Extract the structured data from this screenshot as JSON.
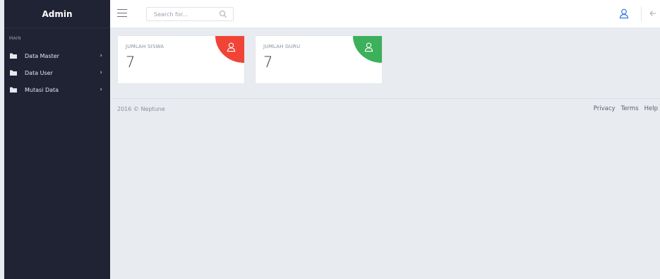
{
  "sidebar": {
    "brand": "Admin",
    "section_label": "MAIN",
    "items": [
      {
        "label": "Data Master",
        "icon": "folder-icon"
      },
      {
        "label": "Data User",
        "icon": "folder-icon"
      },
      {
        "label": "Mutasi Data",
        "icon": "folder-icon"
      }
    ]
  },
  "header": {
    "search_placeholder": "Search for...",
    "icons": [
      "menu-icon",
      "search-icon",
      "user-icon",
      "arrow-left-icon"
    ]
  },
  "cards": [
    {
      "title": "JUMLAH SISWA",
      "value": "7",
      "color": "#f04437",
      "icon": "user-icon"
    },
    {
      "title": "JUMLAH GURU",
      "value": "7",
      "color": "#3cb05a",
      "icon": "user-icon"
    }
  ],
  "footer": {
    "copyright": "2016 © Neptune",
    "links": [
      "Privacy",
      "Terms",
      "Help"
    ]
  },
  "colors": {
    "sidebar_bg": "#1f2333",
    "page_bg": "#e8ebef",
    "accent_blue": "#2f7be0"
  }
}
